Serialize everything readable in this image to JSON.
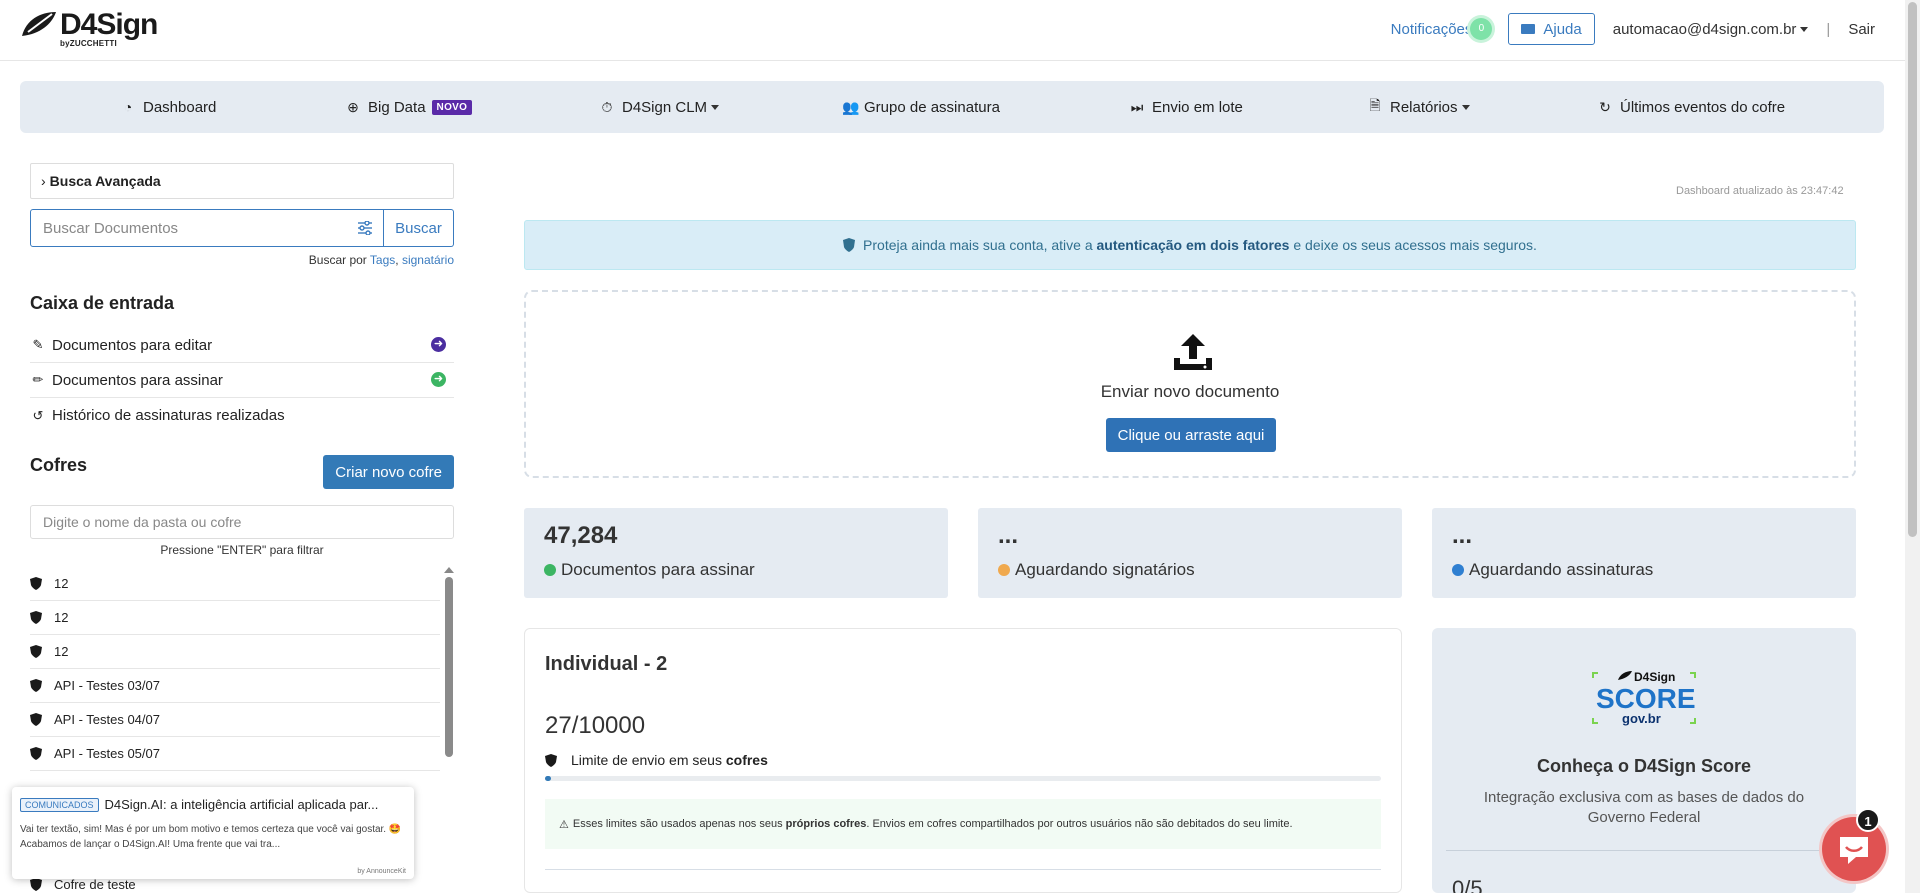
{
  "app": {
    "logo_text": "D4Sign",
    "logo_sub_prefix": "by",
    "logo_sub": "ZUCCHETTI"
  },
  "header": {
    "notifications_label": "Notificações",
    "notifications_count": "0",
    "help_label": "Ajuda",
    "user_email": "automacao@d4sign.com.br",
    "separator": "|",
    "logout_label": "Sair"
  },
  "nav": {
    "dashboard": "Dashboard",
    "bigdata": "Big Data",
    "bigdata_badge": "NOVO",
    "clm": "D4Sign CLM",
    "signature_group": "Grupo de assinatura",
    "batch_send": "Envio em lote",
    "reports": "Relatórios",
    "vault_events": "Últimos eventos do cofre"
  },
  "sidebar": {
    "advanced_search": "Busca Avançada",
    "search_placeholder": "Buscar Documentos",
    "search_button": "Buscar",
    "search_hint_prefix": "Buscar por",
    "search_hint_tags": "Tags",
    "search_hint_sep": ",",
    "search_hint_signer": "signatário",
    "inbox_title": "Caixa de entrada",
    "inbox_items": [
      {
        "label": "Documentos para editar"
      },
      {
        "label": "Documentos para assinar"
      },
      {
        "label": "Histórico de assinaturas realizadas"
      }
    ],
    "vaults_title": "Cofres",
    "create_vault_button": "Criar novo cofre",
    "folder_filter_placeholder": "Digite o nome da pasta ou cofre",
    "folder_filter_hint": "Pressione \"ENTER\" para filtrar",
    "vaults": [
      {
        "name": "12"
      },
      {
        "name": "12"
      },
      {
        "name": "12"
      },
      {
        "name": "API - Testes 03/07"
      },
      {
        "name": "API - Testes 04/07"
      },
      {
        "name": "API - Testes 05/07"
      }
    ],
    "vault_last_visible": "Cofre de teste"
  },
  "announcement": {
    "tag": "COMUNICADOS",
    "title": "D4Sign.AI: a inteligência artificial aplicada par...",
    "body": "Vai ter textão, sim! Mas é por um bom motivo e temos certeza que você vai gostar. 🤩 Acabamos de lançar o D4Sign.AI! Uma frente que vai tra...",
    "footer": "by AnnounceKit"
  },
  "main": {
    "updated_text": "Dashboard atualizado às 23:47:42",
    "alert_prefix": "Proteja ainda mais sua conta, ative a",
    "alert_link": "autenticação em dois fatores",
    "alert_suffix": "e deixe os seus acessos mais seguros.",
    "upload_label": "Enviar novo documento",
    "upload_button": "Clique ou arraste aqui",
    "stats": [
      {
        "value": "47,284",
        "label": "Documentos para assinar",
        "color": "#3cb563"
      },
      {
        "value": "...",
        "label": "Aguardando signatários",
        "color": "#f0a94e"
      },
      {
        "value": "...",
        "label": "Aguardando assinaturas",
        "color": "#2f7fd1"
      }
    ],
    "plan": {
      "title": "Individual - 2",
      "count": "27/10000",
      "usage_fraction": 0.0027,
      "limit_prefix": "Limite de envio em seus",
      "limit_bold": "cofres",
      "warn_prefix": "Esses limites são usados apenas nos seus",
      "warn_bold": "próprios cofres",
      "warn_suffix": ". Envios em cofres compartilhados por outros usuários não são debitados do seu limite."
    },
    "score": {
      "logo_brand": "D4Sign",
      "logo_word": "SCORE",
      "logo_gov": "gov.br",
      "title": "Conheça o D4Sign Score",
      "description": "Integração exclusiva com as bases de dados do Governo Federal",
      "count": "0/5"
    }
  },
  "chat": {
    "badge": "1"
  },
  "colors": {
    "primary": "#337ab7",
    "nav_bg": "#e5ebf2",
    "alert_bg": "#d9edf7",
    "new_badge": "#5a2aa8",
    "chat": "#e05252"
  }
}
